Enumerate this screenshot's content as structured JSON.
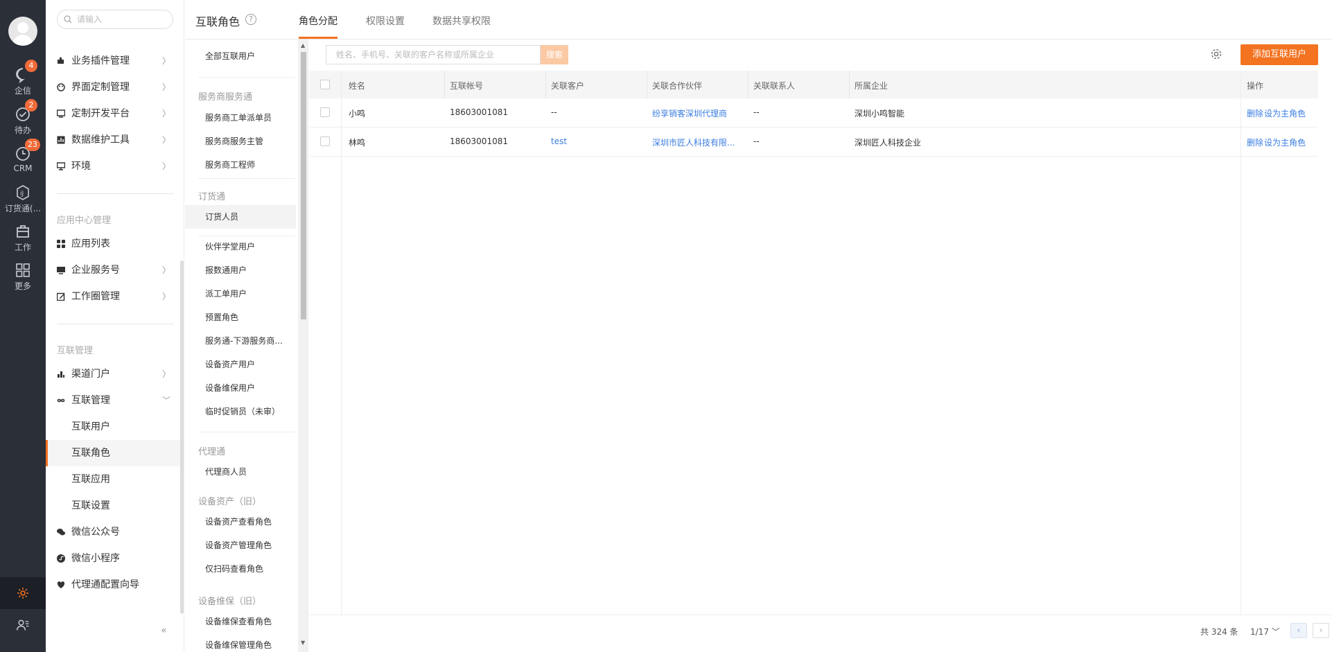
{
  "rail": {
    "items": [
      {
        "label": "企信",
        "badge": "4",
        "icon": "chat-icon"
      },
      {
        "label": "待办",
        "badge": "2",
        "icon": "check-icon"
      },
      {
        "label": "CRM",
        "badge": "23",
        "icon": "clock-icon"
      },
      {
        "label": "订货通(...",
        "badge": "",
        "icon": "order-icon"
      },
      {
        "label": "工作",
        "badge": "",
        "icon": "briefcase-icon"
      },
      {
        "label": "更多",
        "badge": "",
        "icon": "grid-icon"
      }
    ]
  },
  "nav": {
    "search_placeholder": "请输入",
    "items_top": [
      "业务插件管理",
      "界面定制管理",
      "定制开发平台",
      "数据维护工具",
      "环境"
    ],
    "section_app": "应用中心管理",
    "items_app": [
      "应用列表",
      "企业服务号",
      "工作圈管理"
    ],
    "section_interconnect": "互联管理",
    "items_interconnect": [
      "渠道门户",
      "互联管理"
    ],
    "sub_interconnect": [
      "互联用户",
      "互联角色",
      "互联应用",
      "互联设置"
    ],
    "items_bottom": [
      "微信公众号",
      "微信小程序",
      "代理通配置向导"
    ]
  },
  "header": {
    "title": "互联角色",
    "help": "?",
    "tabs": [
      "角色分配",
      "权限设置",
      "数据共享权限"
    ]
  },
  "roles": {
    "all": "全部互联用户",
    "section1": "服务商服务通",
    "group1": [
      "服务商工单派单员",
      "服务商服务主管",
      "服务商工程师"
    ],
    "section2": "订货通",
    "group2": [
      "订货人员"
    ],
    "group3": [
      "伙伴学堂用户",
      "报数通用户",
      "派工单用户",
      "预置角色",
      "服务通-下游服务商...",
      "设备资产用户",
      "设备维保用户",
      "临时促销员（未审）"
    ],
    "section3": "代理通",
    "group4": [
      "代理商人员"
    ],
    "section4": "设备资产（旧）",
    "group5": [
      "设备资产查看角色",
      "设备资产管理角色",
      "仅扫码查看角色"
    ],
    "section5": "设备维保（旧）",
    "group6": [
      "设备维保查看角色",
      "设备维保管理角色"
    ]
  },
  "toolbar": {
    "search_placeholder": "姓名、手机号、关联的客户名称或所属企业",
    "search_button": "搜索",
    "add_button": "添加互联用户"
  },
  "table": {
    "columns": [
      "姓名",
      "互联帐号",
      "关联客户",
      "关联合作伙伴",
      "关联联系人",
      "所属企业",
      "操作"
    ],
    "rows": [
      {
        "name": "小鸣",
        "account": "18603001081",
        "customer": "--",
        "partner": "纷享销客深圳代理商",
        "contact": "--",
        "company": "深圳小鸣智能",
        "op_delete": "删除",
        "op_main": "设为主角色"
      },
      {
        "name": "林鸣",
        "account": "18603001081",
        "customer": "test",
        "partner": "深圳市匠人科技有限...",
        "contact": "--",
        "company": "深圳匠人科技企业",
        "op_delete": "删除",
        "op_main": "设为主角色"
      }
    ]
  },
  "pager": {
    "total": "共 324 条",
    "page": "1/17",
    "prev": "‹",
    "next": "›"
  },
  "colors": {
    "accent": "#f37321",
    "link": "#3a7de0",
    "rail": "#2b2f38"
  }
}
